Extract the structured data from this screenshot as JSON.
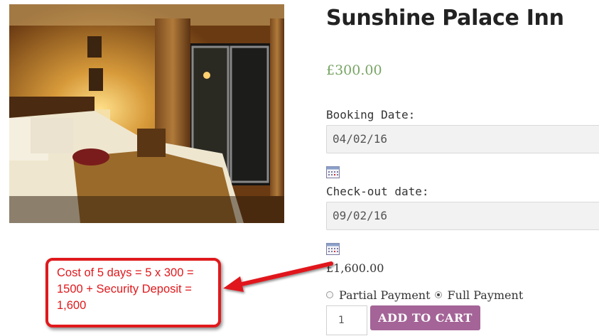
{
  "product": {
    "title": "Sunshine Palace Inn",
    "price": "£300.00",
    "image_alt": "Hotel bedroom photo",
    "booking_date_label": "Booking Date:",
    "booking_date_value": "04/02/16",
    "checkout_date_label": "Check-out date:",
    "checkout_date_value": "09/02/16",
    "total_price": "£1,600.00",
    "payment_options": [
      {
        "label": "Partial Payment",
        "checked": false
      },
      {
        "label": "Full Payment",
        "checked": true
      }
    ],
    "quantity": "1",
    "add_to_cart_label": "ADD TO CART"
  },
  "annotation": {
    "lines": [
      "Cost of 5 days = 5 x 300 =",
      "1500 + Security Deposit =",
      "1,600"
    ],
    "color": "#e0191c"
  },
  "colors": {
    "price": "#77a464",
    "button": "#a46497"
  },
  "icons": [
    "calendar-icon",
    "calendar-icon"
  ]
}
